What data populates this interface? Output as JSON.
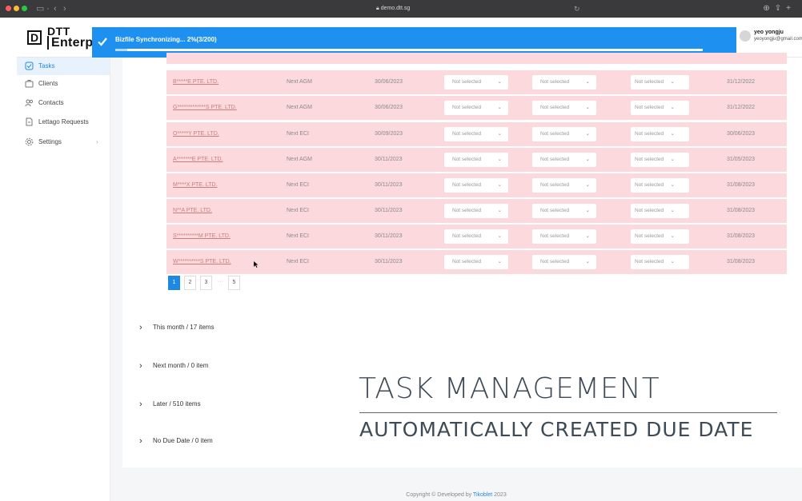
{
  "browser": {
    "url": "demo.dtt.sg"
  },
  "app": {
    "logo_top": "DTT",
    "logo_bottom": "Enterprise",
    "logo_letter": "D"
  },
  "sync": {
    "message": "Bizfile Synchronizing... 2%(3/200)",
    "progress_fraction": 0.02,
    "color": "#1e90ef"
  },
  "user": {
    "name": "yeo yongju",
    "email": "yeoyongju@gmail.com"
  },
  "sidebar": {
    "items": [
      {
        "label": "Tasks",
        "icon": "task-icon",
        "active": true
      },
      {
        "label": "Clients",
        "icon": "clients-icon"
      },
      {
        "label": "Contacts",
        "icon": "contacts-icon"
      },
      {
        "label": "Lettago Requests",
        "icon": "request-icon"
      },
      {
        "label": "Settings",
        "icon": "settings-icon"
      }
    ]
  },
  "table": {
    "select_placeholder": "Not selected",
    "rows": [
      {
        "company": "B*****E PTE. LTD.",
        "type": "Next AGM",
        "due": "30/06/2023",
        "date2": "31/12/2022"
      },
      {
        "company": "G*************S PTE. LTD.",
        "type": "Next AGM",
        "due": "30/06/2023",
        "date2": "31/12/2022"
      },
      {
        "company": "O*****Y PTE. LTD.",
        "type": "Next ECI",
        "due": "30/09/2023",
        "date2": "30/06/2023"
      },
      {
        "company": "A*******E PTE. LTD.",
        "type": "Next AGM",
        "due": "30/11/2023",
        "date2": "31/05/2023"
      },
      {
        "company": "M****X PTE. LTD.",
        "type": "Next ECI",
        "due": "30/11/2023",
        "date2": "31/08/2023"
      },
      {
        "company": "N**A PTE. LTD.",
        "type": "Next ECI",
        "due": "30/11/2023",
        "date2": "31/08/2023"
      },
      {
        "company": "S**********M PTE. LTD.",
        "type": "Next ECI",
        "due": "30/11/2023",
        "date2": "31/08/2023"
      },
      {
        "company": "W**********S PTE. LTD.",
        "type": "Next ECI",
        "due": "30/11/2023",
        "date2": "31/08/2023"
      }
    ]
  },
  "pagination": {
    "pages": [
      "1",
      "2",
      "3",
      "5"
    ],
    "ellipsis": "···",
    "active_page": "1"
  },
  "groups": [
    {
      "label": "This month / 17 items"
    },
    {
      "label": "Next month / 0 item"
    },
    {
      "label": "Later / 510 items"
    },
    {
      "label": "No Due Date / 0 item"
    }
  ],
  "overlay": {
    "title": "TASK MANAGEMENT",
    "subtitle": "AUTOMATICALLY CREATED DUE DATE"
  },
  "footer": {
    "prefix": "Copyright © Developed by",
    "brand": "Tikoblet",
    "year": "2023"
  }
}
